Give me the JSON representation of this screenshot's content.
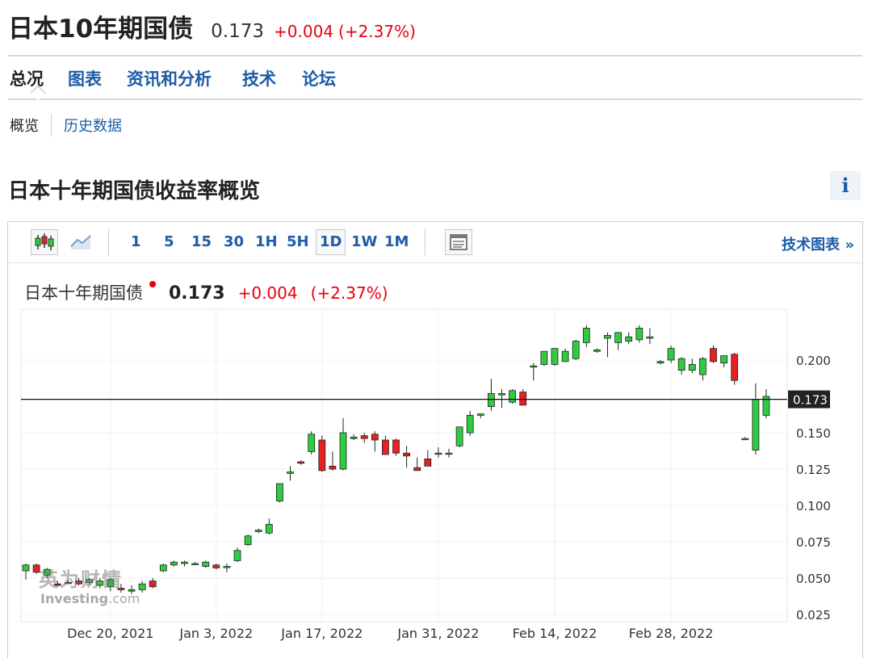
{
  "header": {
    "title": "日本10年期国债",
    "price": "0.173",
    "change": "+0.004",
    "change_pct": "(+2.37%)"
  },
  "nav": {
    "tabs": [
      {
        "label": "总况",
        "active": true
      },
      {
        "label": "图表",
        "active": false
      },
      {
        "label": "资讯和分析",
        "active": false
      },
      {
        "label": "技术",
        "active": false
      },
      {
        "label": "论坛",
        "active": false
      }
    ]
  },
  "subnav": {
    "active": "概览",
    "link": "历史数据"
  },
  "section": {
    "title": "日本十年期国债收益率概览",
    "info_icon": "i"
  },
  "toolbar": {
    "timeframes": [
      "1",
      "5",
      "15",
      "30",
      "1H",
      "5H",
      "1D",
      "1W",
      "1M"
    ],
    "selected_timeframe": "1D",
    "tech_chart_label": "技术图表 »"
  },
  "chart_header": {
    "name": "日本十年期国债",
    "price": "0.173",
    "change": "+0.004",
    "change_pct": "(+2.37%)"
  },
  "watermark": {
    "cn": "英为财情",
    "en_main": "Investing",
    "en_suffix": ".com"
  },
  "colors": {
    "up": "#2ecc40",
    "down": "#e52222",
    "accent_red": "#e8000f",
    "link_blue": "#1d5ca8"
  },
  "chart_data": {
    "type": "candlestick",
    "title": "",
    "xlabel": "",
    "ylabel": "",
    "ylim": [
      0.02,
      0.235
    ],
    "y_ticks": [
      0.025,
      0.05,
      0.075,
      0.1,
      0.125,
      0.15,
      0.2
    ],
    "y_tick_labels": [
      "0.025",
      "0.050",
      "0.075",
      "0.100",
      "0.125",
      "0.150",
      "0.200"
    ],
    "x_ticks": [
      {
        "label": "Dec 20, 2021",
        "index": 8
      },
      {
        "label": "Jan 3, 2022",
        "index": 18
      },
      {
        "label": "Jan 17, 2022",
        "index": 28
      },
      {
        "label": "Jan 31, 2022",
        "index": 39
      },
      {
        "label": "Feb 14, 2022",
        "index": 50
      },
      {
        "label": "Feb 28, 2022",
        "index": 61
      }
    ],
    "current_value": 0.173,
    "current_label": "0.173",
    "grid": true,
    "candles": [
      [
        0.055,
        0.06,
        0.049,
        0.059
      ],
      [
        0.059,
        0.06,
        0.053,
        0.054
      ],
      [
        0.052,
        0.057,
        0.05,
        0.056
      ],
      [
        0.046,
        0.048,
        0.044,
        0.045
      ],
      [
        0.047,
        0.049,
        0.046,
        0.047
      ],
      [
        0.048,
        0.05,
        0.045,
        0.046
      ],
      [
        0.047,
        0.05,
        0.045,
        0.049
      ],
      [
        0.045,
        0.05,
        0.043,
        0.048
      ],
      [
        0.044,
        0.05,
        0.041,
        0.049
      ],
      [
        0.043,
        0.046,
        0.04,
        0.042
      ],
      [
        0.041,
        0.045,
        0.039,
        0.042
      ],
      [
        0.042,
        0.048,
        0.04,
        0.046
      ],
      [
        0.048,
        0.05,
        0.043,
        0.044
      ],
      [
        0.055,
        0.06,
        0.054,
        0.059
      ],
      [
        0.059,
        0.062,
        0.058,
        0.061
      ],
      [
        0.06,
        0.062,
        0.058,
        0.061
      ],
      [
        0.06,
        0.061,
        0.059,
        0.06
      ],
      [
        0.058,
        0.062,
        0.057,
        0.061
      ],
      [
        0.059,
        0.06,
        0.056,
        0.057
      ],
      [
        0.058,
        0.06,
        0.054,
        0.058
      ],
      [
        0.062,
        0.071,
        0.061,
        0.069
      ],
      [
        0.073,
        0.08,
        0.072,
        0.079
      ],
      [
        0.082,
        0.084,
        0.081,
        0.083
      ],
      [
        0.081,
        0.091,
        0.08,
        0.087
      ],
      [
        0.103,
        0.114,
        0.102,
        0.115
      ],
      [
        0.122,
        0.127,
        0.117,
        0.123
      ],
      [
        0.13,
        0.131,
        0.128,
        0.129
      ],
      [
        0.137,
        0.151,
        0.135,
        0.149
      ],
      [
        0.145,
        0.148,
        0.123,
        0.124
      ],
      [
        0.127,
        0.137,
        0.124,
        0.125
      ],
      [
        0.125,
        0.16,
        0.124,
        0.15
      ],
      [
        0.146,
        0.149,
        0.145,
        0.147
      ],
      [
        0.148,
        0.15,
        0.143,
        0.146
      ],
      [
        0.149,
        0.151,
        0.137,
        0.145
      ],
      [
        0.145,
        0.148,
        0.136,
        0.135
      ],
      [
        0.145,
        0.146,
        0.134,
        0.136
      ],
      [
        0.136,
        0.141,
        0.126,
        0.134
      ],
      [
        0.126,
        0.133,
        0.125,
        0.124
      ],
      [
        0.132,
        0.138,
        0.127,
        0.127
      ],
      [
        0.136,
        0.14,
        0.133,
        0.136
      ],
      [
        0.136,
        0.139,
        0.133,
        0.136
      ],
      [
        0.141,
        0.147,
        0.14,
        0.154
      ],
      [
        0.15,
        0.165,
        0.148,
        0.162
      ],
      [
        0.162,
        0.163,
        0.16,
        0.163
      ],
      [
        0.168,
        0.187,
        0.165,
        0.177
      ],
      [
        0.176,
        0.18,
        0.167,
        0.177
      ],
      [
        0.171,
        0.18,
        0.17,
        0.179
      ],
      [
        0.178,
        0.18,
        0.17,
        0.169
      ],
      [
        0.196,
        0.198,
        0.186,
        0.196
      ],
      [
        0.197,
        0.206,
        0.196,
        0.206
      ],
      [
        0.197,
        0.208,
        0.196,
        0.208
      ],
      [
        0.199,
        0.208,
        0.199,
        0.206
      ],
      [
        0.201,
        0.214,
        0.2,
        0.213
      ],
      [
        0.212,
        0.224,
        0.209,
        0.222
      ],
      [
        0.206,
        0.208,
        0.205,
        0.207
      ],
      [
        0.215,
        0.219,
        0.202,
        0.217
      ],
      [
        0.212,
        0.218,
        0.207,
        0.219
      ],
      [
        0.213,
        0.219,
        0.211,
        0.216
      ],
      [
        0.214,
        0.224,
        0.212,
        0.222
      ],
      [
        0.215,
        0.222,
        0.211,
        0.216
      ],
      [
        0.198,
        0.2,
        0.197,
        0.199
      ],
      [
        0.2,
        0.21,
        0.198,
        0.208
      ],
      [
        0.193,
        0.202,
        0.19,
        0.201
      ],
      [
        0.193,
        0.201,
        0.191,
        0.197
      ],
      [
        0.19,
        0.202,
        0.186,
        0.201
      ],
      [
        0.208,
        0.21,
        0.198,
        0.199
      ],
      [
        0.198,
        0.203,
        0.195,
        0.203
      ],
      [
        0.204,
        0.205,
        0.183,
        0.186
      ],
      [
        0.146,
        0.147,
        0.145,
        0.146
      ],
      [
        0.138,
        0.184,
        0.135,
        0.173
      ],
      [
        0.162,
        0.18,
        0.16,
        0.175
      ]
    ]
  }
}
